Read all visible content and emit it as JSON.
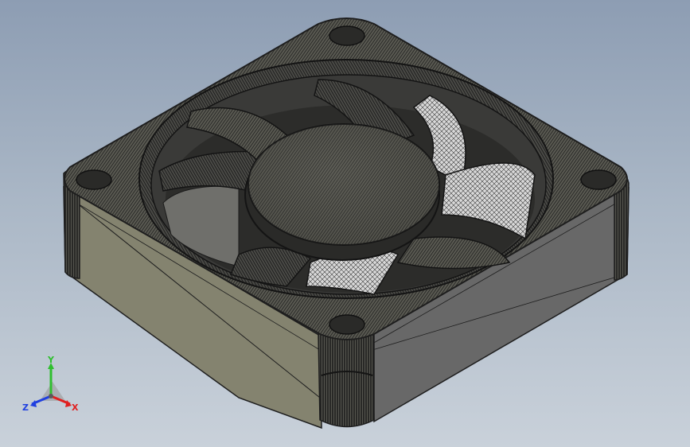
{
  "viewport": {
    "background_top": "#8d9db3",
    "background_bottom": "#c9d1da"
  },
  "model": {
    "body_color": "#84836f",
    "body_shadow": "#6b6a5a",
    "mesh_color": "#1e1e1e",
    "blade_highlight": "#e8e8e8"
  },
  "triad": {
    "x_label": "X",
    "y_label": "Y",
    "z_label": "Z",
    "x_color": "#e02020",
    "y_color": "#2fbf2f",
    "z_color": "#2040e0"
  }
}
